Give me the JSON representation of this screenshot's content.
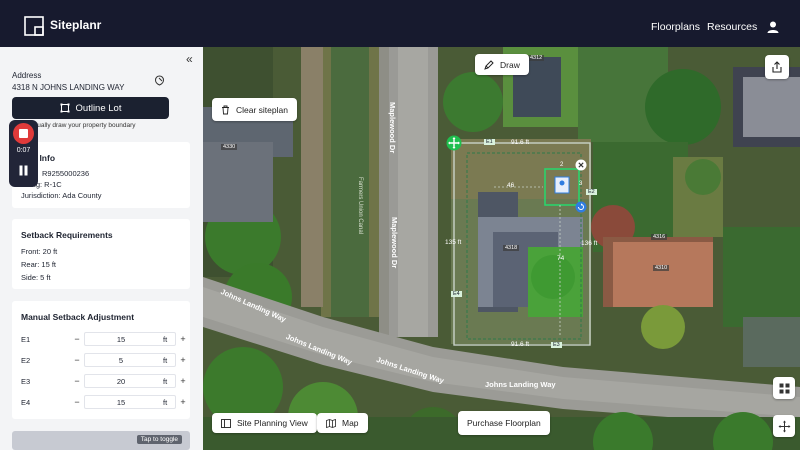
{
  "header": {
    "brand": "Siteplanr",
    "nav": [
      "Floorplans",
      "Resources"
    ]
  },
  "sidebar": {
    "address_label": "Address",
    "address_value": "4318 N JOHNS LANDING WAY",
    "outline_button": "Outline Lot",
    "outline_hint": "anually draw your property boundary",
    "parcel": {
      "title": "el Info",
      "line1": "R9255000236",
      "line2": "ing: R-1C",
      "line3": "Jurisdiction: Ada County"
    },
    "setback": {
      "title": "Setback Requirements",
      "front": "Front: 20 ft",
      "rear": "Rear: 15 ft",
      "side": "Side: 5 ft"
    },
    "manual": {
      "title": "Manual Setback Adjustment",
      "unit": "ft",
      "minus": "−",
      "plus": "+",
      "rows": [
        {
          "label": "E1",
          "value": "15"
        },
        {
          "label": "E2",
          "value": "5"
        },
        {
          "label": "E3",
          "value": "20"
        },
        {
          "label": "E4",
          "value": "15"
        }
      ]
    },
    "tap_toggle": "Tap to toggle"
  },
  "recorder": {
    "time": "0:07"
  },
  "map": {
    "draw_button": "Draw",
    "clear_button": "Clear siteplan",
    "site_planning_button": "Site Planning View",
    "map_button": "Map",
    "purchase_button": "Purchase Floorplan",
    "labels": {
      "maplewood_1": "Maplewood Dr",
      "maplewood_2": "Maplewood Dr",
      "canal": "Farmers Union Canal",
      "johns_1": "Johns Landing Way",
      "johns_2": "Johns Landing Way",
      "johns_3": "Johns Landing Way",
      "johns_4": "Johns Landing Way",
      "house_4312": "4312",
      "house_4318": "4318",
      "house_4310": "4310",
      "house_4316": "4316",
      "house_4330": "4330"
    },
    "lot": {
      "e1_top": "E1",
      "e2": "E2",
      "e3": "E3",
      "e4": "E4",
      "top_dim": "91.6 ft",
      "bottom_dim": "91.6 ft",
      "left_dim": "135 ft",
      "right_dim": "136 ft",
      "w46": "46",
      "d74": "74",
      "n2": "2",
      "n3": "3"
    },
    "colors": {
      "lot_outline": "#c9d2c8",
      "setback_dash": "#2f7a4a",
      "selection": "#2bd36b",
      "handle_green": "#1fbf4e",
      "handle_blue": "#2f7de1"
    }
  }
}
